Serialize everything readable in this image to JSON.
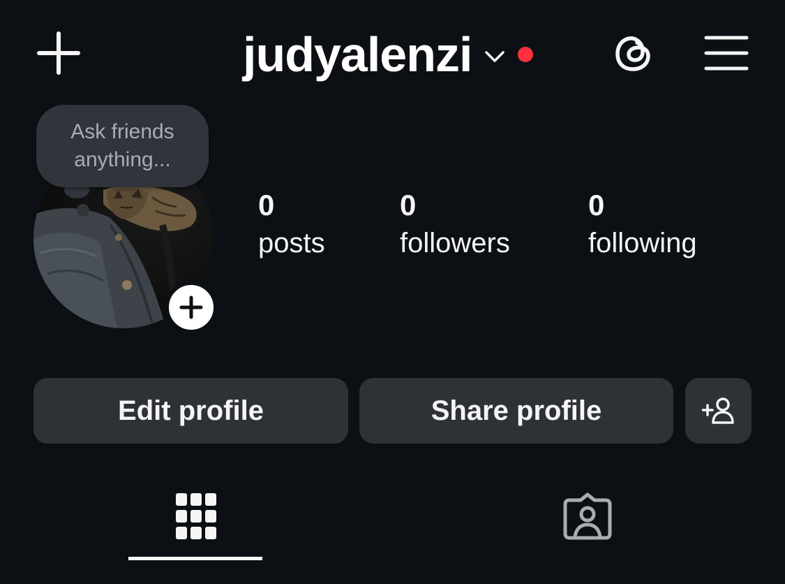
{
  "header": {
    "username": "judyalenzi",
    "icons": [
      "plus-icon",
      "chevron-down-icon",
      "notification-dot",
      "threads-icon",
      "hamburger-menu-icon"
    ],
    "notification_color": "#ff3040"
  },
  "profile": {
    "note_text_line1": "Ask friends",
    "note_text_line2": "anything...",
    "avatar": "profile-photo-cat-on-jeans",
    "stats": {
      "posts_count": "0",
      "posts_label": "posts",
      "followers_count": "0",
      "followers_label": "followers",
      "following_count": "0",
      "following_label": "following"
    }
  },
  "actions": {
    "edit_label": "Edit profile",
    "share_label": "Share profile",
    "discover_icon": "add-person-icon"
  },
  "tabs": {
    "items": [
      "grid-icon",
      "tagged-photos-icon"
    ],
    "active": "grid-icon"
  },
  "colors": {
    "background": "#0c1014",
    "button": "#2e3237",
    "text": "#f5f5f5",
    "muted": "#a8adb4"
  }
}
